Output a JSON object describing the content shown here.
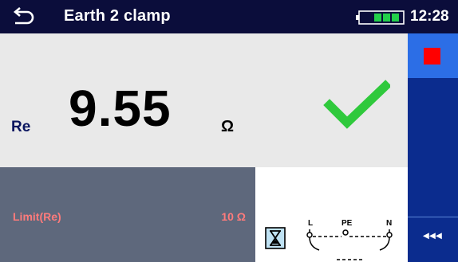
{
  "header": {
    "title": "Earth 2 clamp",
    "time": "12:28"
  },
  "result": {
    "label": "Re",
    "value": "9.55",
    "unit": "Ω",
    "status": "pass"
  },
  "limit": {
    "label": "Limit(Re)",
    "value": "10 Ω"
  },
  "connection": {
    "terminals": [
      "L",
      "PE",
      "N"
    ]
  },
  "sidebar": {
    "back_label": "◂◂◂"
  },
  "colors": {
    "header_bg": "#0b0d3b",
    "sidebar_bg": "#0b2c8e",
    "stop_button_bg": "#2c6ee6",
    "pass_check": "#2fc93c",
    "limit_text": "#ff7b7b",
    "limit_panel_bg": "#5e687c"
  },
  "icons": {
    "back": "back-arrow-icon",
    "battery": "battery-icon",
    "pass": "checkmark-icon",
    "stop": "stop-icon",
    "timer": "hourglass-icon"
  }
}
